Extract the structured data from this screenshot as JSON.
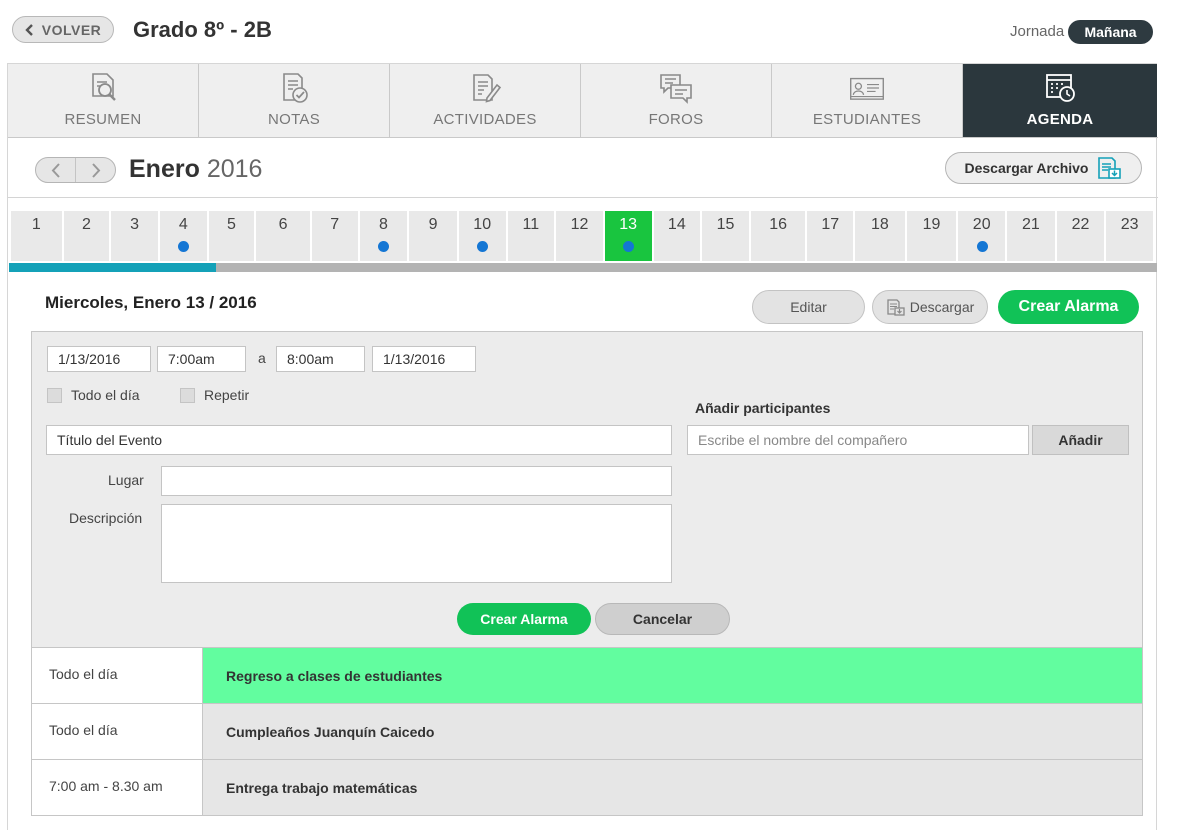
{
  "header": {
    "back_label": "VOLVER",
    "title": "Grado 8º - 2B",
    "jornada_label": "Jornada",
    "jornada_value": "Mañana"
  },
  "tabs": [
    {
      "label": "RESUMEN",
      "icon": "document-search-icon",
      "active": false
    },
    {
      "label": "NOTAS",
      "icon": "clipboard-check-icon",
      "active": false
    },
    {
      "label": "ACTIVIDADES",
      "icon": "document-edit-icon",
      "active": false
    },
    {
      "label": "FOROS",
      "icon": "chat-bubbles-icon",
      "active": false
    },
    {
      "label": "ESTUDIANTES",
      "icon": "id-card-icon",
      "active": false
    },
    {
      "label": "AGENDA",
      "icon": "calendar-clock-icon",
      "active": true
    }
  ],
  "calendar": {
    "month": "Enero",
    "year": "2016",
    "download_file_label": "Descargar Archivo",
    "days": [
      {
        "n": "1",
        "event": false
      },
      {
        "n": "2",
        "event": false
      },
      {
        "n": "3",
        "event": false
      },
      {
        "n": "4",
        "event": true
      },
      {
        "n": "5",
        "event": false
      },
      {
        "n": "6",
        "event": false
      },
      {
        "n": "7",
        "event": false
      },
      {
        "n": "8",
        "event": true
      },
      {
        "n": "9",
        "event": false
      },
      {
        "n": "10",
        "event": true
      },
      {
        "n": "11",
        "event": false
      },
      {
        "n": "12",
        "event": false
      },
      {
        "n": "13",
        "event": true,
        "selected": true
      },
      {
        "n": "14",
        "event": false
      },
      {
        "n": "15",
        "event": false
      },
      {
        "n": "16",
        "event": false
      },
      {
        "n": "17",
        "event": false
      },
      {
        "n": "18",
        "event": false
      },
      {
        "n": "19",
        "event": false
      },
      {
        "n": "20",
        "event": true
      },
      {
        "n": "21",
        "event": false
      },
      {
        "n": "22",
        "event": false
      },
      {
        "n": "23",
        "event": false
      }
    ],
    "progress": 0.18
  },
  "day_view": {
    "selected_date": "Miercoles, Enero 13 / 2016",
    "edit_label": "Editar",
    "download_label": "Descargar",
    "create_alarm_label": "Crear Alarma"
  },
  "form": {
    "start_date": "1/13/2016",
    "start_time": "7:00am",
    "separator": "a",
    "end_time": "8:00am",
    "end_date": "1/13/2016",
    "all_day_label": "Todo el día",
    "repeat_label": "Repetir",
    "title_placeholder": "Título del Evento",
    "place_label": "Lugar",
    "description_label": "Descripción",
    "participants_label": "Añadir participantes",
    "participants_placeholder": "Escribe el nombre del compañero",
    "add_label": "Añadir",
    "submit_label": "Crear Alarma",
    "cancel_label": "Cancelar"
  },
  "events": [
    {
      "time": "Todo el día",
      "title": "Regreso a clases de estudiantes",
      "highlight": true
    },
    {
      "time": "Todo el día",
      "title": "Cumpleaños Juanquín Caicedo",
      "highlight": false
    },
    {
      "time": "7:00 am - 8.30 am",
      "title": "Entrega trabajo matemáticas",
      "highlight": false
    }
  ],
  "colors": {
    "accent_green": "#11c257",
    "selected_day": "#19c53f",
    "event_dot": "#1476d4",
    "progress": "#14a1b8",
    "highlight_event": "#62fd9f",
    "active_tab": "#2b373d"
  }
}
